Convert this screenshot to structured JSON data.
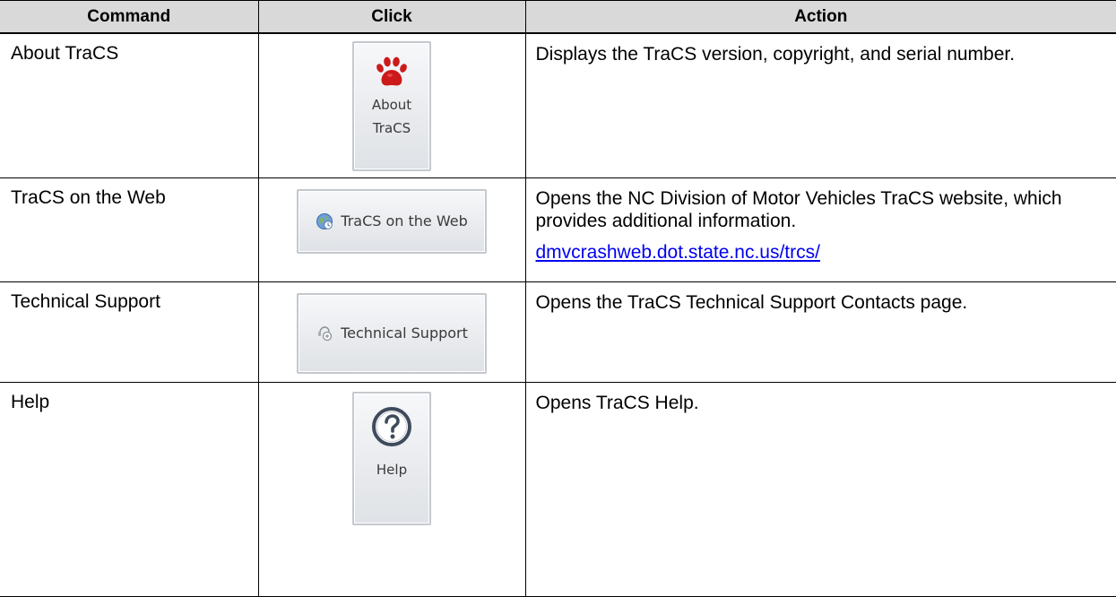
{
  "table": {
    "headers": {
      "command": "Command",
      "click": "Click",
      "action": "Action"
    },
    "rows": [
      {
        "command": "About TraCS",
        "button": {
          "line1": "About",
          "line2": "TraCS",
          "icon": "paw-icon"
        },
        "action": "Displays the TraCS version, copyright, and serial number."
      },
      {
        "command": "TraCS on the Web",
        "button": {
          "label": "TraCS on the Web",
          "icon": "globe-icon"
        },
        "action": "Opens the NC Division of Motor Vehicles TraCS website, which provides additional information.",
        "link": "dmvcrashweb.dot.state.nc.us/trcs/"
      },
      {
        "command": "Technical Support",
        "button": {
          "label": "Technical Support",
          "icon": "support-icon"
        },
        "action": "Opens the TraCS Technical Support Contacts page."
      },
      {
        "command": "Help",
        "button": {
          "label": "Help",
          "icon": "help-question-icon"
        },
        "action": "Opens TraCS Help."
      }
    ]
  },
  "colors": {
    "header_bg": "#d9d9d9",
    "link": "#0000ee",
    "paw_red": "#cc1a1a",
    "help_icon_border": "#3f4b5c"
  }
}
